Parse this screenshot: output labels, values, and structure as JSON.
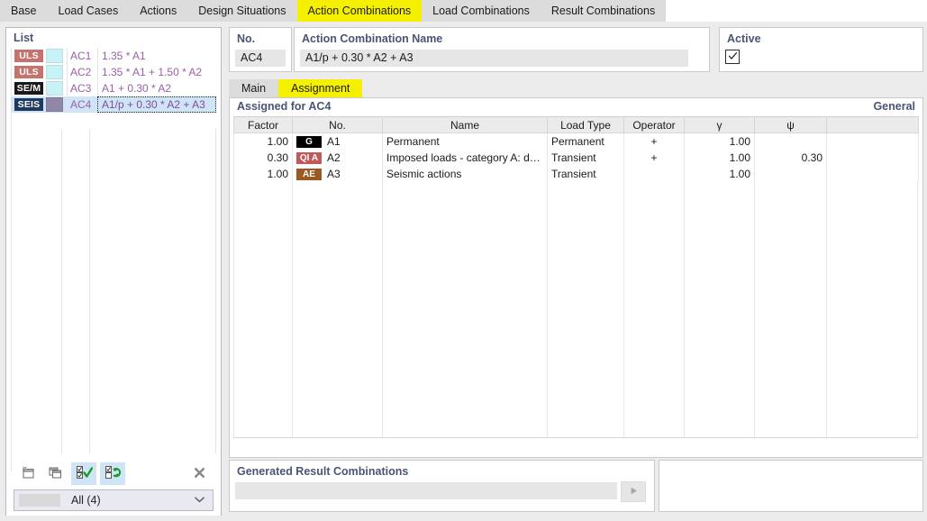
{
  "window": {
    "accent_yellow": "#f5f000",
    "accent_blue": "#4a5575",
    "selection_blue": "#cfe4f7"
  },
  "tabbar": {
    "tabs": [
      {
        "label": "Base",
        "active": false
      },
      {
        "label": "Load Cases",
        "active": false
      },
      {
        "label": "Actions",
        "active": false
      },
      {
        "label": "Design Situations",
        "active": false
      },
      {
        "label": "Action Combinations",
        "active": true
      },
      {
        "label": "Load Combinations",
        "active": false
      },
      {
        "label": "Result Combinations",
        "active": false
      }
    ]
  },
  "list_panel": {
    "title": "List",
    "rows": [
      {
        "badge": "ULS",
        "badge_color": "#c4736e",
        "swatch_color": "#c9f2f7",
        "no": "AC1",
        "expression": "1.35 * A1",
        "selected": false
      },
      {
        "badge": "ULS",
        "badge_color": "#c4736e",
        "swatch_color": "#c9f2f7",
        "no": "AC2",
        "expression": "1.35 * A1 + 1.50 * A2",
        "selected": false
      },
      {
        "badge": "SE/M",
        "badge_color": "#191919",
        "swatch_color": "#c9f2f7",
        "no": "AC3",
        "expression": "A1 + 0.30 * A2",
        "selected": false
      },
      {
        "badge": "SEIS",
        "badge_color": "#1f3a5f",
        "swatch_color": "#8f86a8",
        "no": "AC4",
        "expression": "A1/p + 0.30 * A2 + A3",
        "selected": true
      }
    ],
    "toolbar": {
      "new_icon": "new-window-icon",
      "copy_icon": "copy-window-icon",
      "select_all_icon": "check-all-icon",
      "invert_icon": "toggle-check-icon",
      "delete_icon": "close-x-icon"
    },
    "filter": {
      "label": "All (4)",
      "arrow_icon": "chevron-down-icon"
    }
  },
  "detail": {
    "no_label": "No.",
    "no_value": "AC4",
    "name_label": "Action Combination Name",
    "name_value": "A1/p + 0.30 * A2 + A3",
    "edit_icon": "edit-pencil-icon",
    "active_label": "Active",
    "active_checked": true,
    "check_icon": "checkmark-icon"
  },
  "inner_tabs": [
    {
      "label": "Main",
      "active": false
    },
    {
      "label": "Assignment",
      "active": true
    }
  ],
  "assignment": {
    "heading": "Assigned for AC4",
    "heading_right": "General",
    "columns": [
      "Factor",
      "No.",
      "Name",
      "Load Type",
      "Operator",
      "γ",
      "ψ",
      ""
    ],
    "rows": [
      {
        "factor": "1.00",
        "badge": "G",
        "badge_color": "#000000",
        "no": "A1",
        "name": "Permanent",
        "load_type": "Permanent",
        "operator": "+",
        "gamma": "1.00",
        "psi": "",
        "extra": ""
      },
      {
        "factor": "0.30",
        "badge": "QI A",
        "badge_color": "#c05a5a",
        "no": "A2",
        "name": "Imposed loads - category A: dom...",
        "load_type": "Transient",
        "operator": "+",
        "gamma": "1.00",
        "psi": "0.30",
        "extra": ""
      },
      {
        "factor": "1.00",
        "badge": "AE",
        "badge_color": "#9b5a22",
        "no": "A3",
        "name": "Seismic actions",
        "load_type": "Transient",
        "operator": "",
        "gamma": "1.00",
        "psi": "",
        "extra": ""
      }
    ]
  },
  "generated": {
    "label": "Generated Result Combinations",
    "value": "",
    "go_icon": "play-arrow-icon"
  }
}
